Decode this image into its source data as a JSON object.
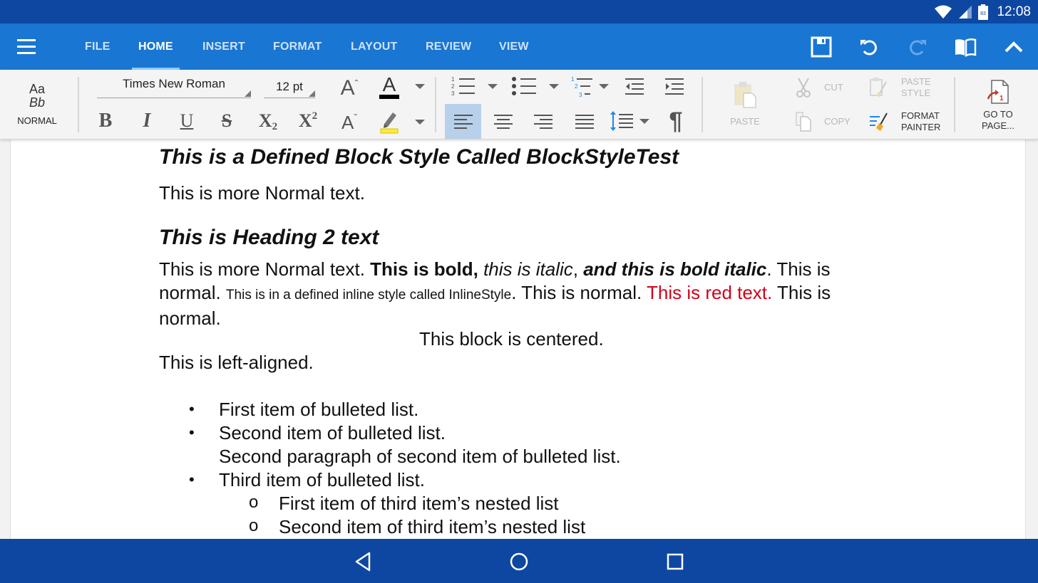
{
  "status_bar": {
    "time": "12:08",
    "battery_level": "83",
    "icons": [
      "wifi-icon",
      "signal-icon",
      "battery-icon"
    ]
  },
  "app_bar": {
    "menu_icon": "hamburger-menu-icon",
    "tabs": [
      {
        "label": "FILE",
        "active": false
      },
      {
        "label": "HOME",
        "active": true
      },
      {
        "label": "INSERT",
        "active": false
      },
      {
        "label": "FORMAT",
        "active": false
      },
      {
        "label": "LAYOUT",
        "active": false
      },
      {
        "label": "REVIEW",
        "active": false
      },
      {
        "label": "VIEW",
        "active": false
      }
    ],
    "actions": [
      {
        "name": "save-icon",
        "enabled": true
      },
      {
        "name": "undo-icon",
        "enabled": true
      },
      {
        "name": "redo-icon",
        "enabled": false
      },
      {
        "name": "read-mode-icon",
        "enabled": true
      },
      {
        "name": "collapse-ribbon-icon",
        "enabled": true
      }
    ]
  },
  "ribbon": {
    "style": {
      "preview_top": "Aa",
      "preview_bottom": "Bb",
      "label": "NORMAL"
    },
    "font_name": "Times New Roman",
    "font_size": "12 pt",
    "grow_font_glyph": "A",
    "shrink_font_glyph": "A",
    "font_color_glyph": "A",
    "bold_glyph": "B",
    "italic_glyph": "I",
    "underline_glyph": "U",
    "strike_glyph": "S",
    "subscript_glyph": "X",
    "subscript_small": "2",
    "superscript_glyph": "X",
    "superscript_small": "2",
    "pilcrow_glyph": "¶",
    "colors": {
      "font_color": "#000000",
      "highlight_color": "#ffeb3b",
      "active_alignment_bg": "#b8d0ea"
    },
    "active_alignment": "left",
    "clipboard": {
      "paste_label": "PASTE",
      "cut_label": "CUT",
      "copy_label": "COPY",
      "paste_style_label_1": "PASTE",
      "paste_style_label_2": "STYLE",
      "format_painter_label_1": "FORMAT",
      "format_painter_label_2": "PAINTER"
    },
    "goto": {
      "label_1": "GO TO",
      "label_2": "PAGE...",
      "page_glyph": "1"
    }
  },
  "document": {
    "block_style_heading": "This is a Defined Block Style Called BlockStyleTest",
    "normal_1": "This is more Normal text.",
    "heading_2": "This is Heading 2 text",
    "para": {
      "normal_a": "This is more Normal text. ",
      "bold": "This is bold,",
      "italic": " this is italic",
      "comma": ",",
      "bold_italic": " and this is bold italic",
      "normal_b": ". This is normal. ",
      "inline_style": "This is in a defined inline style called InlineStyle",
      "normal_c": ". This is normal. ",
      "red": "This is red text.",
      "normal_d": " This is normal."
    },
    "centered": "This block is centered.",
    "left_aligned": "This is left-aligned.",
    "bullet_glyph": "•",
    "nested_bullet_glyph": "o",
    "list": [
      "First item of bulleted list.",
      "Second item of bulleted list.",
      "Second paragraph of second item of bulleted list.",
      "Third item of bulleted list."
    ],
    "nested_list": [
      "First item of third item’s nested list",
      "Second item of third item’s nested list"
    ]
  },
  "nav_bar": {
    "buttons": [
      "back-icon",
      "home-icon",
      "recents-icon"
    ]
  }
}
